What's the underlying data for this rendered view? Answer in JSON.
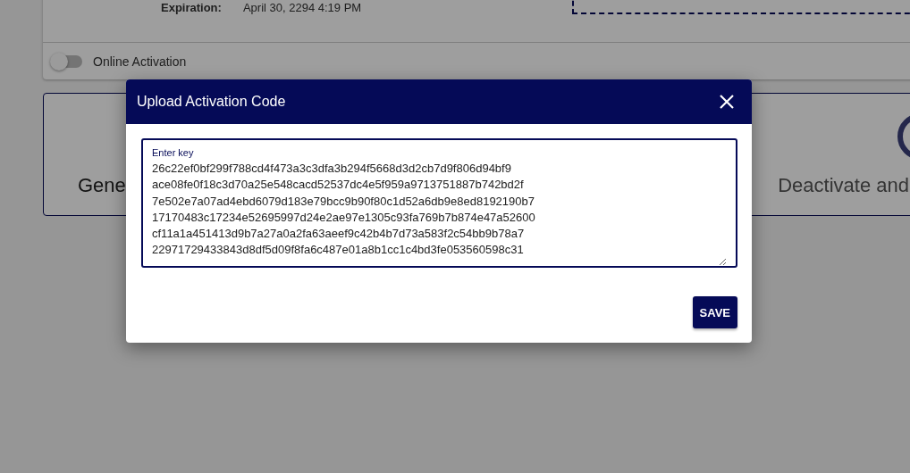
{
  "license_card": {
    "expiration_label": "Expiration:",
    "expiration_value": "April 30, 2294 4:19 PM",
    "online_activation": {
      "label": "Online Activation",
      "on": false
    }
  },
  "options_card": {
    "options": [
      {
        "label": "Gene"
      },
      {
        "label": "Deactivate and"
      }
    ]
  },
  "dialog": {
    "title": "Upload Activation Code",
    "field": {
      "label": "Enter key",
      "value": "26c22ef0bf299f788cd4f473a3c3dfa3b294f5668d3d2cb7d9f806d94bf9\nace08fe0f18c3d70a25e548cacd52537dc4e5f959a9713751887b742bd2f\n7e502e7a07ad4ebd6079d183e79bcc9b90f80c1d52a6db9e8ed8192190b7\n17170483c17234e52695997d24e2ae97e1305c93fa769b7b874e47a52600\ncf11a1a451413d9b7a27a0a2fa63aeef9c42b4b7d73a583f2c54bb9b78a7\n22971729433843d8df5d09f8fa6c487e01a8b1cc1c4bd3fe053560598c31"
    },
    "buttons": [
      {
        "label": "SAVE"
      }
    ]
  }
}
